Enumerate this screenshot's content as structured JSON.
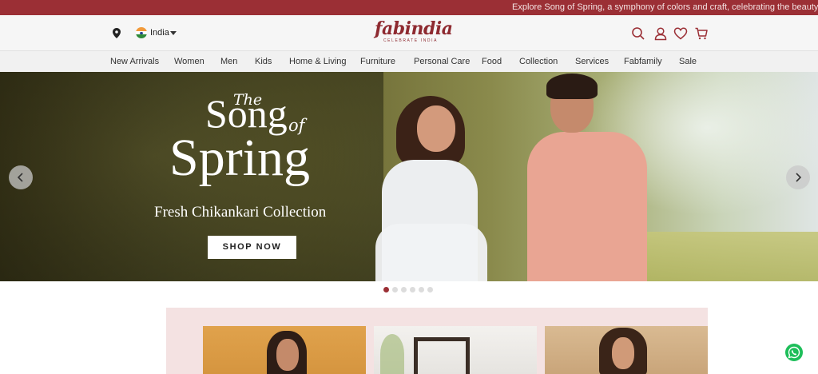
{
  "announcement": {
    "text": "Explore Song of Spring, a symphony of colors and craft, celebrating the beauty of new b"
  },
  "header": {
    "country": "India",
    "logo_word": "fabindia",
    "logo_tagline": "CELEBRATE INDIA",
    "icons": [
      "location-pin-icon",
      "india-flag-icon",
      "search-icon",
      "user-icon",
      "heart-icon",
      "cart-icon"
    ]
  },
  "nav": {
    "items": [
      "New Arrivals",
      "Women",
      "Men",
      "Kids",
      "Home & Living",
      "Furniture",
      "Personal Care",
      "Food",
      "Collection",
      "Services",
      "Fabfamily",
      "Sale"
    ]
  },
  "hero": {
    "title_the": "The",
    "title_song": "Song",
    "title_of": "of",
    "title_spring": "Spring",
    "subtitle": "Fresh Chikankari Collection",
    "cta": "SHOP NOW",
    "slide_count": 6,
    "active_slide": 1
  },
  "colors": {
    "brand": "#9b2f35",
    "active_dot": "#9b2f35",
    "whatsapp": "#1ebe5a"
  }
}
